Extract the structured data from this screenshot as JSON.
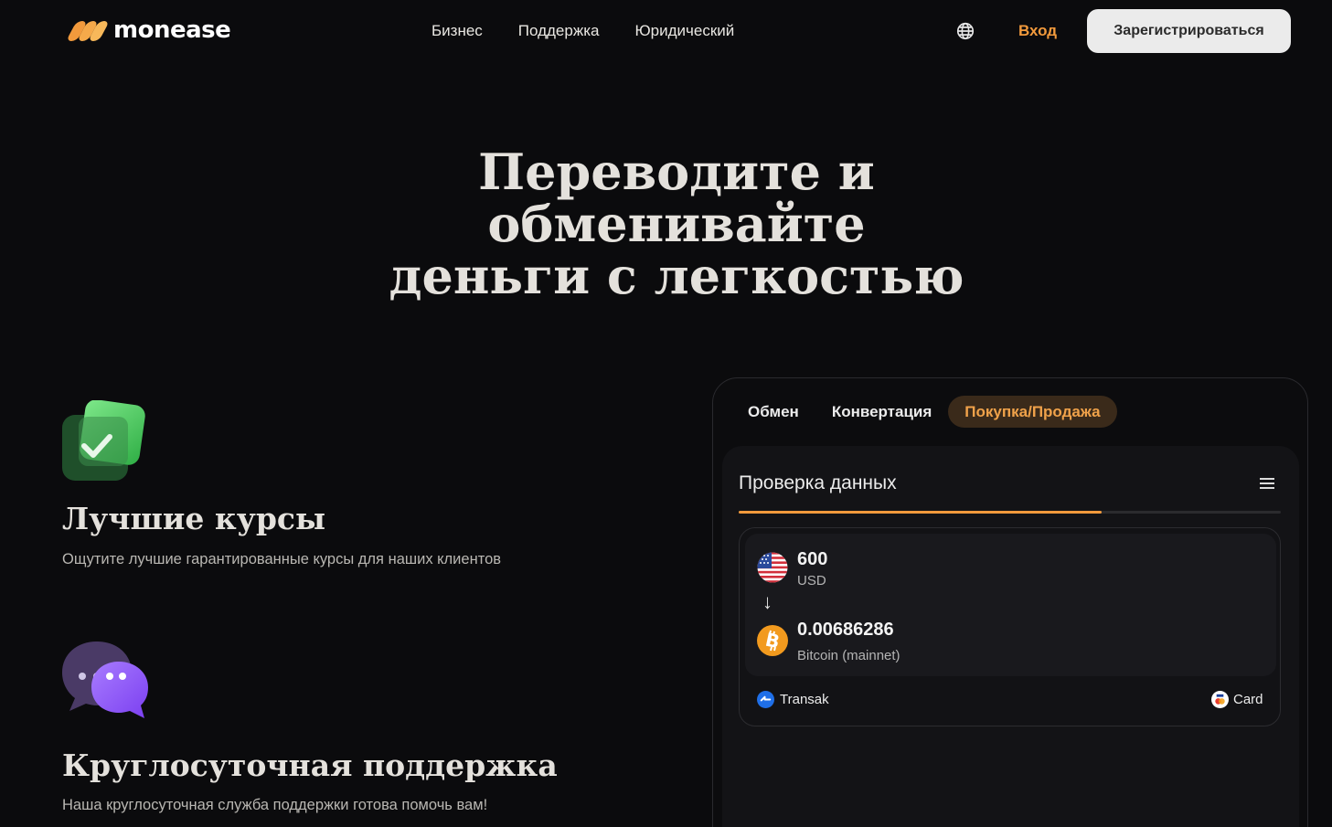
{
  "header": {
    "logo_text": "monease",
    "nav": [
      "Бизнес",
      "Поддержка",
      "Юридический"
    ],
    "language_icon": "globe-icon",
    "login_label": "Вход",
    "register_label": "Зарегистрироваться",
    "accent_color": "#f29a3c"
  },
  "hero": {
    "title_lines": [
      "Переводите и",
      "обменивайте",
      "деньги с легкостью"
    ]
  },
  "features": [
    {
      "icon": "checkmark-card-icon",
      "title": "Лучшие курсы",
      "description": "Ощутите лучшие гарантированные курсы для наших клиентов"
    },
    {
      "icon": "chat-bubbles-icon",
      "title": "Круглосуточная поддержка",
      "description": "Наша круглосуточная служба поддержки готова помочь вам!"
    }
  ],
  "widget": {
    "tabs": [
      "Обмен",
      "Конвертация",
      "Покупка/Продажа"
    ],
    "active_tab": "Покупка/Продажа",
    "panel_title": "Проверка данных",
    "menu_icon": "hamburger-menu-icon",
    "progress": 0.67,
    "from": {
      "amount": "600",
      "currency": "USD",
      "icon": "us-flag-icon"
    },
    "to": {
      "amount": "0.00686286",
      "currency": "Bitcoin (mainnet)",
      "icon": "bitcoin-icon"
    },
    "arrow": "↓",
    "provider": {
      "name": "Transak",
      "icon": "transak-icon"
    },
    "payment_method": {
      "name": "Card",
      "icon": "visa-mastercard-icon"
    }
  }
}
